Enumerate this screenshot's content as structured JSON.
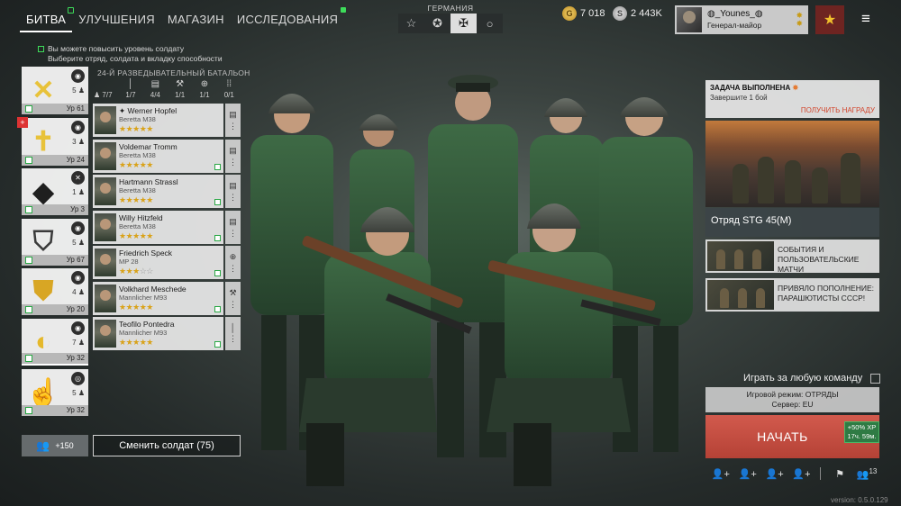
{
  "nav": {
    "items": [
      {
        "label": "БИТВА",
        "active": true
      },
      {
        "label": "УЛУЧШЕНИЯ",
        "active": false
      },
      {
        "label": "МАГАЗИН",
        "active": false
      },
      {
        "label": "ИССЛЕДОВАНИЯ",
        "active": false
      }
    ]
  },
  "info": {
    "line1": "Вы можете повысить уровень солдату",
    "line2": "Выберите отряд, солдата и вкладку способности"
  },
  "nation": {
    "label": "ГЕРМАНИЯ",
    "tabs": [
      {
        "icon": "star-outline-icon",
        "glyph": "☆"
      },
      {
        "icon": "star-circle-icon",
        "glyph": "✪"
      },
      {
        "icon": "iron-cross-icon",
        "glyph": "✠"
      },
      {
        "icon": "circle-icon",
        "glyph": "○"
      }
    ]
  },
  "currency": {
    "gold": "7 018",
    "silver": "2 443K"
  },
  "profile": {
    "name": "◍_Younes_◍",
    "rank": "Генерал-майор",
    "badge_glyph": "★"
  },
  "squads": [
    {
      "icon": "crossed-rifles-emblem",
      "glyph": "✕",
      "type": "◉",
      "count": "5",
      "level": "Ур 61",
      "selected": false,
      "plus": false,
      "color": "#e8c23a"
    },
    {
      "icon": "cross-emblem",
      "glyph": "✝",
      "type": "◉",
      "count": "3",
      "level": "Ур 24",
      "selected": false,
      "plus": true,
      "color": "#e8c23a"
    },
    {
      "icon": "diamond-emblem",
      "glyph": "◆",
      "type": "✕",
      "count": "1",
      "level": "Ур 3",
      "selected": false,
      "plus": false,
      "color": "#1f1f1f"
    },
    {
      "icon": "shield-emblem",
      "glyph": "⛉",
      "type": "◉",
      "count": "5",
      "level": "Ур 67",
      "selected": false,
      "plus": false,
      "color": "#3a3a3a"
    },
    {
      "icon": "tower-shield-emblem",
      "glyph": "⛊",
      "type": "◉",
      "count": "4",
      "level": "Ур 20",
      "selected": false,
      "plus": false,
      "color": "#d8a624"
    },
    {
      "icon": "eagle-emblem",
      "glyph": "◐",
      "type": "◉",
      "count": "7",
      "level": "Ур 32",
      "selected": true,
      "plus": false,
      "color": "#e5b82a"
    },
    {
      "icon": "radio-emblem",
      "glyph": "☝",
      "type": "◎",
      "count": "5",
      "level": "Ур 32",
      "selected": false,
      "plus": false,
      "color": "#222"
    }
  ],
  "battalion": {
    "title": "24-Й РАЗВЕДЫВАТЕЛЬНЫЙ БАТАЛЬОН",
    "stats": [
      {
        "icon": "",
        "value": "7/7"
      },
      {
        "icon": "│",
        "value": "1/7"
      },
      {
        "icon": "▤",
        "value": "4/4"
      },
      {
        "icon": "⚒",
        "value": "1/1"
      },
      {
        "icon": "⊕",
        "value": "1/1"
      },
      {
        "icon": "⁞⁞",
        "value": "0/1"
      }
    ]
  },
  "soldiers": [
    {
      "name": "Werner Hopfel",
      "weapon": "Beretta M38",
      "stars": 5,
      "side": "▤",
      "leader": true
    },
    {
      "name": "Voldemar Tromm",
      "weapon": "Beretta M38",
      "stars": 5,
      "side": "▤",
      "leader": false
    },
    {
      "name": "Hartmann Strassl",
      "weapon": "Beretta M38",
      "stars": 5,
      "side": "▤",
      "leader": false
    },
    {
      "name": "Willy Hitzfeld",
      "weapon": "Beretta M38",
      "stars": 5,
      "side": "▤",
      "leader": false
    },
    {
      "name": "Friedrich Speck",
      "weapon": "MP 28",
      "stars": 3,
      "side": "⊕",
      "leader": false
    },
    {
      "name": "Volkhard Meschede",
      "weapon": "Mannlicher M93",
      "stars": 5,
      "side": "⚒",
      "leader": false
    },
    {
      "name": "Teofilo Pontedra",
      "weapon": "Mannlicher M93",
      "stars": 5,
      "side": "│",
      "leader": false
    }
  ],
  "buttons": {
    "reserve_count": "+150",
    "change_soldier": "Сменить солдат (75)",
    "start": "НАЧАТЬ"
  },
  "mission": {
    "title": "ЗАДАЧА ВЫПОЛНЕНА",
    "subtitle": "Завершите 1 бой",
    "reward": "ПОЛУЧИТЬ НАГРАДУ"
  },
  "promo": {
    "caption": "Отряд STG 45(M)"
  },
  "events": [
    {
      "text": "СОБЫТИЯ И ПОЛЬЗОВАТЕЛЬСКИЕ МАТЧИ"
    },
    {
      "text": "ПРИВЯЛО ПОПОЛНЕНИЕ: ПАРАШЮТИСТЫ СССР!"
    }
  ],
  "matchmaking": {
    "any_team": "Играть за любую команду",
    "mode": "Игровой режим: ОТРЯДЫ",
    "server": "Сервер: EU",
    "xp_bonus": "+50% XP",
    "xp_timer": "17ч. 59м."
  },
  "bottom": {
    "friends_count": "13",
    "version": "version: 0.5.0.129"
  },
  "colors": {
    "accent_green": "#3ddc5a",
    "start_red": "#c44b3f",
    "reward_red": "#d2462d",
    "star_gold": "#d9a219"
  }
}
